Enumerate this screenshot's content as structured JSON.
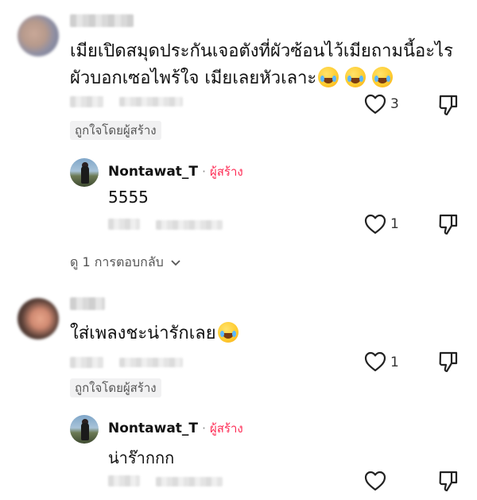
{
  "comments": [
    {
      "text": "เมียเปิดสมุดประกันเจอตังที่ผัวซ้อนไว้เมียถามนี้อะไรผัวบอกเซอไพร้ใจ เมียเลยหัวเลาะ",
      "emoji_count": 3,
      "likes": "3",
      "liked_by_creator": "ถูกใจโดยผู้สร้าง",
      "reply": {
        "username": "Nontawat_T",
        "separator": "·",
        "creator_tag": "ผู้สร้าง",
        "text": "5555",
        "likes": "1"
      },
      "view_replies": "ดู 1 การตอบกลับ"
    },
    {
      "text": "ใส่เพลงชะน่ารักเลย",
      "emoji_count": 1,
      "likes": "1",
      "liked_by_creator": "ถูกใจโดยผู้สร้าง",
      "reply": {
        "username": "Nontawat_T",
        "separator": "·",
        "creator_tag": "ผู้สร้าง",
        "text": "น่าร๊ากกก",
        "likes": ""
      }
    }
  ],
  "icons": {
    "like": "heart-outline-icon",
    "dislike": "thumbs-down-outline-icon",
    "expand": "chevron-down-icon",
    "emoji": "laughing-tears-emoji"
  },
  "colors": {
    "creator_accent": "#fe2c55",
    "text_primary": "#111111",
    "text_secondary": "#555555"
  }
}
